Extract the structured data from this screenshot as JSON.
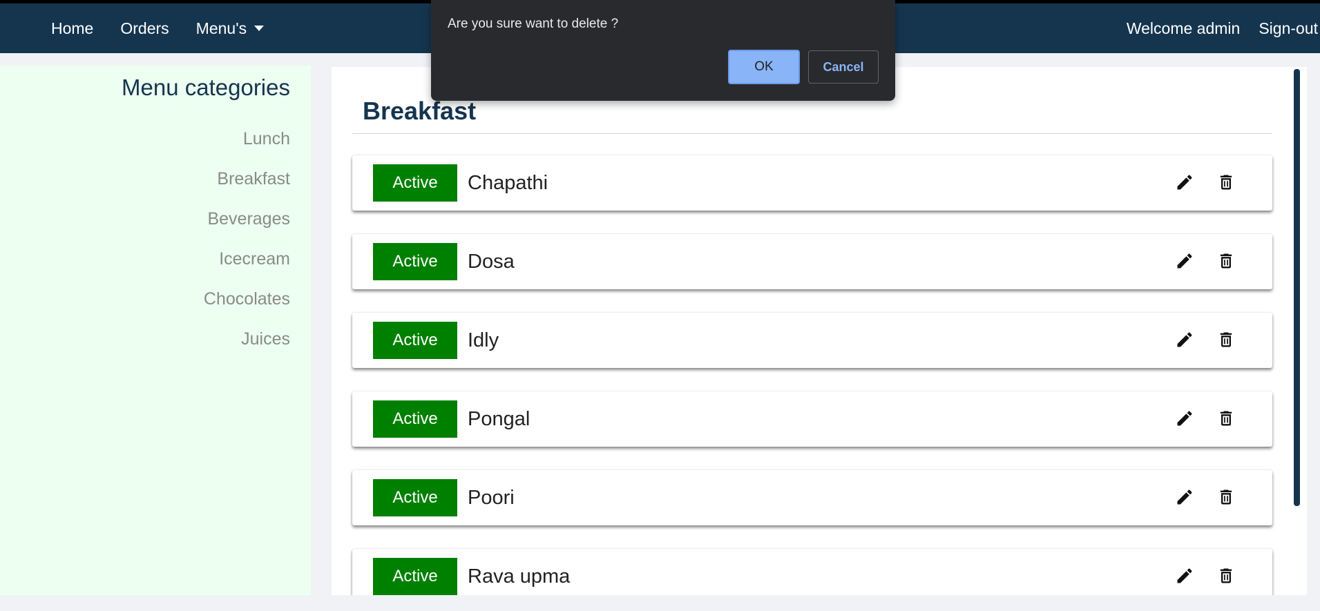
{
  "navbar": {
    "links": [
      {
        "label": "Home"
      },
      {
        "label": "Orders"
      },
      {
        "label": "Menu's"
      }
    ],
    "welcome": "Welcome admin",
    "signout": "Sign-out"
  },
  "sidebar": {
    "title": "Menu categories",
    "categories": [
      "Lunch",
      "Breakfast",
      "Beverages",
      "Icecream",
      "Chocolates",
      "Juices"
    ]
  },
  "main": {
    "title": "Breakfast",
    "items": [
      {
        "status": "Active",
        "name": "Chapathi"
      },
      {
        "status": "Active",
        "name": "Dosa"
      },
      {
        "status": "Active",
        "name": "Idly"
      },
      {
        "status": "Active",
        "name": "Pongal"
      },
      {
        "status": "Active",
        "name": "Poori"
      },
      {
        "status": "Active",
        "name": "Rava upma"
      }
    ]
  },
  "dialog": {
    "message": "Are you sure want to delete ?",
    "ok_label": "OK",
    "cancel_label": "Cancel"
  },
  "colors": {
    "navbar": "#15354f",
    "active_badge": "#008000",
    "sidebar_bg": "#edfff0",
    "dialog_bg": "#292a2d",
    "ok_button": "#8ab4f8"
  },
  "icons": [
    "caret-down-icon",
    "edit-icon",
    "delete-icon"
  ]
}
